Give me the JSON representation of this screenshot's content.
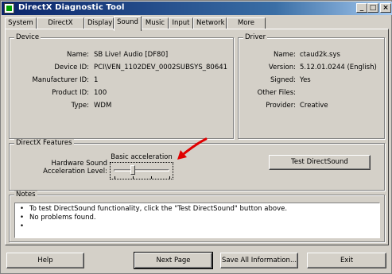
{
  "window": {
    "title": "DirectX Diagnostic Tool",
    "buttons": {
      "minimize": "_",
      "maximize": "□",
      "close": "×"
    }
  },
  "tabs": [
    {
      "label": "System"
    },
    {
      "label": "DirectX Files"
    },
    {
      "label": "Display"
    },
    {
      "label": "Sound",
      "active": true
    },
    {
      "label": "Music"
    },
    {
      "label": "Input"
    },
    {
      "label": "Network"
    },
    {
      "label": "More Help"
    }
  ],
  "device": {
    "group_label": "Device",
    "fields": [
      {
        "label": "Name:",
        "value": "SB Live! Audio [DF80]"
      },
      {
        "label": "Device ID:",
        "value": "PCI\\VEN_1102DEV_0002SUBSYS_80641"
      },
      {
        "label": "Manufacturer ID:",
        "value": "1"
      },
      {
        "label": "Product ID:",
        "value": "100"
      },
      {
        "label": "Type:",
        "value": "WDM"
      }
    ]
  },
  "driver": {
    "group_label": "Driver",
    "fields": [
      {
        "label": "Name:",
        "value": "ctaud2k.sys"
      },
      {
        "label": "Version:",
        "value": "5.12.01.0244 (English)"
      },
      {
        "label": "Signed:",
        "value": "Yes"
      },
      {
        "label": "Other Files:",
        "value": ""
      },
      {
        "label": "Provider:",
        "value": "Creative"
      }
    ]
  },
  "features": {
    "group_label": "DirectX Features",
    "hw_label_line1": "Hardware Sound",
    "hw_label_line2": "Acceleration Level:",
    "slider_caption": "Basic acceleration",
    "slider_position": 0.33,
    "test_button": "Test DirectSound"
  },
  "notes": {
    "group_label": "Notes",
    "items": [
      "To test DirectSound functionality, click the \"Test DirectSound\" button above.",
      "No problems found."
    ]
  },
  "footer": {
    "help": "Help",
    "next_page": "Next Page",
    "save_all": "Save All Information...",
    "exit": "Exit"
  },
  "colors": {
    "title_gradient_start": "#0a246a",
    "face": "#d4d0c8",
    "annotation_arrow": "#e00000"
  }
}
